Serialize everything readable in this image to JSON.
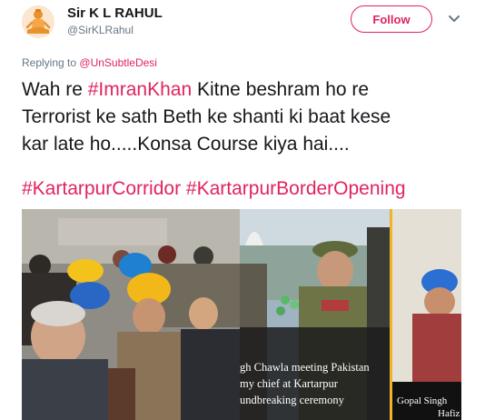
{
  "author": {
    "name": "Sir K L RAHUL",
    "handle": "@SirKLRahul",
    "avatar_icon": "meditating-yogi-icon"
  },
  "follow_label": "Follow",
  "menu_icon": "chevron-down-icon",
  "replying": {
    "prefix": "Replying to",
    "to": "@UnSubtleDesi"
  },
  "tweet": {
    "line1_pre": "Wah re ",
    "mention_tag": "#ImranKhan",
    "line1_post": " Kitne beshram ho re",
    "line2": "Terrorist ke sath Beth ke shanti ki baat kese",
    "line3": "kar late ho.....Konsa Course kiya hai...."
  },
  "hashtags": [
    "#KartarpurCorridor",
    "#KartarpurBorderOpening"
  ],
  "media": {
    "caption_lines": [
      "gh Chawla meeting Pakistan",
      "my chief at Kartarpur",
      "undbreaking ceremony"
    ],
    "caption2_lines": [
      "Gopal Singh",
      "Hafiz"
    ]
  },
  "colors": {
    "accent": "#e0245e",
    "text": "#14171a",
    "secondary": "#657786"
  }
}
